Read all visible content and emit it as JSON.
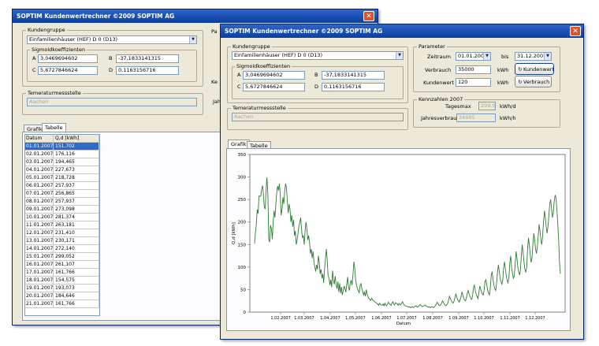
{
  "back_window": {
    "title": "SOPTIM Kundenwertrechner    ©2009 SOPTIM AG",
    "kundengruppe_label": "Kundengruppe",
    "kundengruppe_value": "Einfamilienhäuser (HEF) D 0 (D13)",
    "sigmoid_label": "Sigmoidkoeffizienten",
    "coef": {
      "A": "3,0469694602",
      "B": "-37,1833141315",
      "C": "5,6727846624",
      "D": "0,1163156716"
    },
    "temp_label": "Temeraturmessstelle",
    "temp_value": "Aachen",
    "param_label_partial": "Pa",
    "ke_label_partial": "Ke",
    "jah_label_partial": "Jah",
    "tabs": [
      "Grafik",
      "Tabelle"
    ],
    "table": {
      "headers": [
        "Datum",
        "Q,d [kWh]"
      ],
      "rows": [
        [
          "01.01.2007",
          "151,702"
        ],
        [
          "02.01.2007",
          "176,116"
        ],
        [
          "03.01.2007",
          "194,465"
        ],
        [
          "04.01.2007",
          "227,673"
        ],
        [
          "05.01.2007",
          "218,728"
        ],
        [
          "06.01.2007",
          "257,937"
        ],
        [
          "07.01.2007",
          "256,865"
        ],
        [
          "08.01.2007",
          "257,937"
        ],
        [
          "09.01.2007",
          "273,098"
        ],
        [
          "10.01.2007",
          "281,374"
        ],
        [
          "11.01.2007",
          "263,181"
        ],
        [
          "12.01.2007",
          "231,410"
        ],
        [
          "13.01.2007",
          "230,171"
        ],
        [
          "14.01.2007",
          "272,140"
        ],
        [
          "15.01.2007",
          "299,052"
        ],
        [
          "16.01.2007",
          "261,107"
        ],
        [
          "17.01.2007",
          "161,766"
        ],
        [
          "18.01.2007",
          "154,575"
        ],
        [
          "19.01.2007",
          "193,073"
        ],
        [
          "20.01.2007",
          "184,646"
        ],
        [
          "21.01.2007",
          "161,766"
        ]
      ]
    }
  },
  "front_window": {
    "title": "SOPTIM Kundenwertrechner    ©2009 SOPTIM AG",
    "kundengruppe_label": "Kundengruppe",
    "kundengruppe_value": "Einfamilienhäuser (HEF) D 0 (D13)",
    "sigmoid_label": "Sigmoidkoeffizienten",
    "coef": {
      "A": "3,0469694602",
      "B": "-37,1833141315",
      "C": "5,6727846624",
      "D": "0,1163156716"
    },
    "temp_label": "Temeraturmessstelle",
    "temp_value": "Aachen",
    "parameter": {
      "label": "Parameter",
      "zeitraum_label": "Zeitraum",
      "zeitraum_from": "01.01.2007",
      "bis_label": "bis",
      "zeitraum_to": "31.12.2007",
      "verbrauch_label": "Verbrauch",
      "verbrauch_value": "35000",
      "verbrauch_unit": "kWh",
      "kundenwert_label": "Kundenwert",
      "kundenwert_value": "120",
      "kundenwert_unit": "kWh",
      "btn_kundenwert": "Kundenwert",
      "btn_verbrauch": "Verbrauch"
    },
    "kennzahlen": {
      "label": "Kennzahlen 2007",
      "tagesmax_label": "Tagesmax",
      "tagesmax_value": "299,021",
      "tagesmax_unit": "kWh/d",
      "jahresverbrauch_label": "Jahresverbrauch",
      "jahresverbrauch_value": "34985",
      "jahresverbrauch_unit": "kWh/h"
    },
    "tabs": [
      "Grafik",
      "Tabelle"
    ]
  },
  "icons": {
    "close": "close-icon",
    "dropdown": "chevron-down-icon",
    "refresh": "refresh-icon"
  },
  "colors": {
    "titlebar": "#0b3d9e",
    "window": "#ece9d8",
    "series": "#2e7d32",
    "selection": "#316ac5"
  },
  "chart_data": {
    "type": "line",
    "xlabel": "Datum",
    "ylabel": "Q,d [kWh]",
    "ylim": [
      0,
      350
    ],
    "yticks": [
      0,
      50,
      100,
      150,
      200,
      250,
      300,
      350
    ],
    "xticks": [
      "1.02.2007",
      "1.03.2007",
      "1.04.2007",
      "1.05.2007",
      "1.06.2007",
      "1.07.2007",
      "1.08.2007",
      "1.09.2007",
      "1.10.2007",
      "1.11.2007",
      "1.12.2007"
    ],
    "grid": false,
    "series": [
      {
        "values": [
          152,
          176,
          194,
          228,
          219,
          258,
          257,
          258,
          273,
          281,
          263,
          231,
          230,
          272,
          299,
          261,
          162,
          155,
          193,
          185,
          162,
          200,
          225,
          210,
          240,
          265,
          280,
          270,
          285,
          260,
          215,
          230,
          255,
          240,
          270,
          285,
          275,
          245,
          220,
          240,
          228,
          200,
          215,
          190,
          205,
          170,
          180,
          150,
          160,
          175,
          190,
          200,
          210,
          185,
          165,
          170,
          150,
          180,
          200,
          185,
          160,
          170,
          155,
          130,
          140,
          120,
          135,
          110,
          100,
          90,
          105,
          95,
          125,
          110,
          85,
          95,
          75,
          85,
          65,
          95,
          120,
          140,
          115,
          80,
          75,
          60,
          72,
          55,
          92,
          70,
          62,
          80,
          60,
          52,
          68,
          45,
          64,
          42,
          56,
          38,
          48,
          58,
          52,
          44,
          62,
          78,
          55,
          48,
          66,
          70,
          60,
          82,
          112,
          98,
          72,
          60,
          52,
          48,
          42,
          58,
          64,
          52,
          46,
          38,
          44,
          35,
          50,
          40,
          34,
          30,
          28,
          26,
          31,
          28,
          25,
          24,
          22,
          21,
          19,
          18,
          15,
          20,
          17,
          16,
          15,
          18,
          14,
          20,
          16,
          14,
          18,
          22,
          19,
          17,
          15,
          20,
          23,
          18,
          16,
          21,
          20,
          18,
          15,
          19,
          17,
          16,
          20,
          23,
          18,
          15,
          14,
          13,
          12,
          12,
          11,
          12,
          10,
          11,
          12,
          10,
          11,
          13,
          14,
          12,
          11,
          13,
          15,
          17,
          14,
          12,
          13,
          14,
          16,
          15,
          13,
          12,
          11,
          12,
          10,
          11,
          12,
          11,
          10,
          12,
          14,
          18,
          22,
          19,
          15,
          14,
          16,
          20,
          25,
          22,
          18,
          15,
          14,
          17,
          20,
          28,
          35,
          30,
          25,
          22,
          20,
          24,
          32,
          40,
          35,
          28,
          25,
          22,
          28,
          35,
          45,
          38,
          30,
          27,
          25,
          32,
          42,
          48,
          40,
          35,
          30,
          28,
          38,
          55,
          60,
          48,
          40,
          35,
          30,
          42,
          58,
          52,
          45,
          40,
          38,
          50,
          68,
          72,
          60,
          48,
          42,
          38,
          55,
          82,
          90,
          72,
          60,
          52,
          48,
          62,
          88,
          105,
          92,
          75,
          68,
          62,
          72,
          98,
          112,
          95,
          80,
          70,
          65,
          78,
          110,
          125,
          100,
          85,
          75,
          80,
          105,
          135,
          120,
          100,
          90,
          82,
          95,
          128,
          150,
          130,
          110,
          95,
          88,
          100,
          140,
          165,
          150,
          125,
          110,
          120,
          150,
          175,
          160,
          140,
          130,
          145,
          170,
          195,
          180,
          160,
          150,
          170,
          200,
          225,
          210,
          190,
          175,
          190,
          215,
          240,
          250,
          230,
          210,
          220,
          245,
          260,
          255,
          230,
          200,
          160,
          110,
          85
        ]
      }
    ]
  }
}
